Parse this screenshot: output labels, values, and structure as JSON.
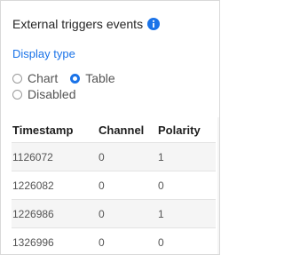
{
  "panel": {
    "title": "External triggers events",
    "info_icon": "info-icon",
    "accent_color": "#1a73e8"
  },
  "display_type": {
    "label": "Display type",
    "options": [
      {
        "label": "Chart",
        "selected": false
      },
      {
        "label": "Table",
        "selected": true
      },
      {
        "label": "Disabled",
        "selected": false
      }
    ]
  },
  "table": {
    "headers": [
      "Timestamp",
      "Channel",
      "Polarity"
    ],
    "rows": [
      {
        "timestamp": "1126072",
        "channel": "0",
        "polarity": "1"
      },
      {
        "timestamp": "1226082",
        "channel": "0",
        "polarity": "0"
      },
      {
        "timestamp": "1226986",
        "channel": "0",
        "polarity": "1"
      },
      {
        "timestamp": "1326996",
        "channel": "0",
        "polarity": "0"
      }
    ]
  }
}
